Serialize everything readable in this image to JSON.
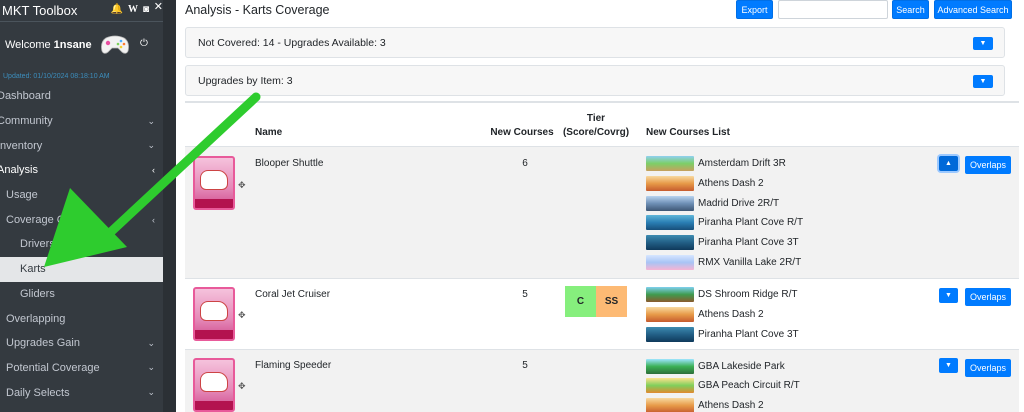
{
  "sidebar": {
    "brand": "MKT Toolbox",
    "close_glyph": "✕",
    "welcome": "Welcome",
    "username": "1nsane",
    "updated": "Updated: 01/10/2024 08:18:10 AM",
    "items": [
      {
        "label": "Dashboard"
      },
      {
        "label": "Community"
      },
      {
        "label": "Inventory"
      },
      {
        "label": "Analysis"
      },
      {
        "label": "Usage"
      },
      {
        "label": "Coverage Gaps"
      },
      {
        "label": "Drivers"
      },
      {
        "label": "Karts"
      },
      {
        "label": "Gliders"
      },
      {
        "label": "Overlapping"
      },
      {
        "label": "Upgrades Gain"
      },
      {
        "label": "Potential Coverage"
      },
      {
        "label": "Daily Selects"
      }
    ]
  },
  "header": {
    "title": "Analysis - Karts Coverage",
    "export_label": "Export",
    "search_value": "",
    "search_label": "Search",
    "advanced_label": "Advanced Search"
  },
  "cards": {
    "not_covered": "Not Covered: 14 - Upgrades Available: 3",
    "by_item": "Upgrades by Item: 3"
  },
  "table": {
    "headers": {
      "name": "Name",
      "new_courses": "New Courses",
      "tier_line1": "Tier",
      "tier_line2": "(Score/Covrg)",
      "list": "New Courses List"
    },
    "rows": [
      {
        "name": "Blooper Shuttle",
        "count": "6",
        "courses": [
          "Amsterdam Drift 3R",
          "Athens Dash 2",
          "Madrid Drive 2R/T",
          "Piranha Plant Cove R/T",
          "Piranha Plant Cove 3T",
          "RMX Vanilla Lake 2R/T"
        ],
        "overlaps": "Overlaps"
      },
      {
        "name": "Coral Jet Cruiser",
        "count": "5",
        "tier_score": "C",
        "tier_cover": "SS",
        "courses": [
          "DS Shroom Ridge R/T",
          "Athens Dash 2",
          "Piranha Plant Cove 3T"
        ],
        "overlaps": "Overlaps"
      },
      {
        "name": "Flaming Speeder",
        "count": "5",
        "courses": [
          "GBA Lakeside Park",
          "GBA Peach Circuit R/T",
          "Athens Dash 2"
        ],
        "overlaps": "Overlaps"
      }
    ]
  },
  "colors": {
    "accent": "#007bff",
    "sidebar": "#343a40",
    "tier_c": "#86ef7d",
    "tier_ss": "#fdba74",
    "arrow": "#2ecc2e"
  }
}
